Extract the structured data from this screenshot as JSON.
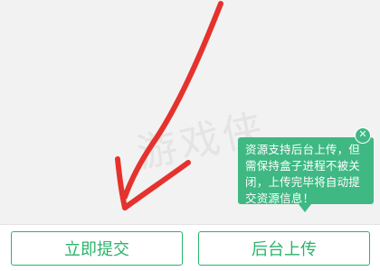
{
  "watermark": "游戏侠",
  "tooltip": {
    "text": "资源支持后台上传，但需保持盒子进程不被关闭，上传完毕将自动提交资源信息！",
    "close_glyph": "✕"
  },
  "buttons": {
    "submit_label": "立即提交",
    "background_upload_label": "后台上传"
  },
  "colors": {
    "accent": "#2ab36a",
    "tooltip_bg": "#3fb883",
    "annotation_arrow": "#e5322d"
  },
  "icons": {
    "close": "close-icon",
    "annotation": "red-arrow-annotation"
  }
}
